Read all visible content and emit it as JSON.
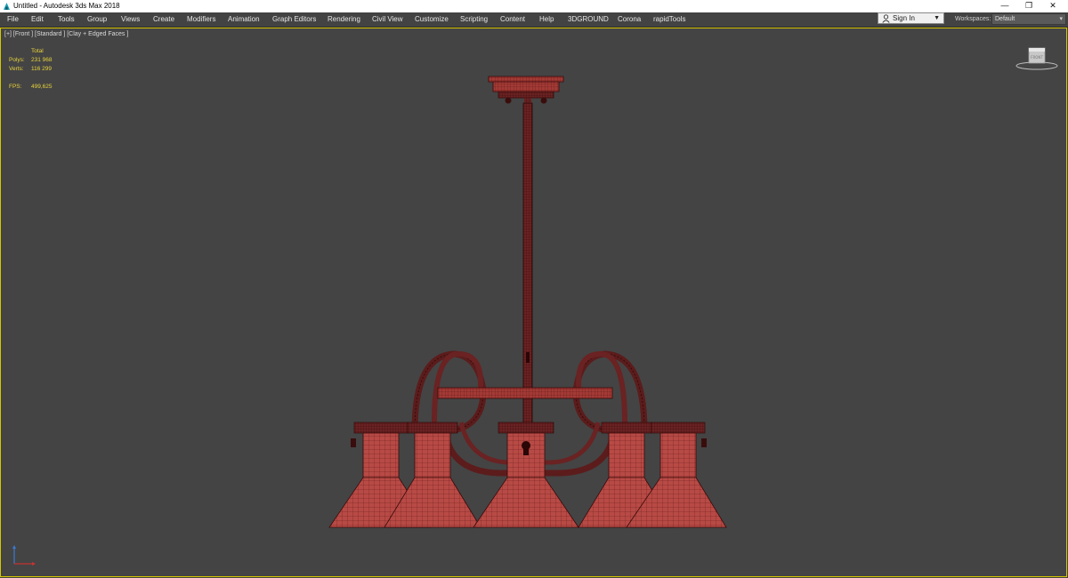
{
  "window": {
    "title": "Untitled - Autodesk 3ds Max 2018",
    "app_icon": "3ds-max-icon",
    "controls": {
      "minimize": "—",
      "restore": "❐",
      "close": "✕"
    }
  },
  "menubar": {
    "items": [
      "File",
      "Edit",
      "Tools",
      "Group",
      "Views",
      "Create",
      "Modifiers",
      "Animation",
      "Graph Editors",
      "Rendering",
      "Civil View",
      "Customize",
      "Scripting",
      "Content",
      "Help",
      "3DGROUND",
      "Corona",
      "rapidTools"
    ],
    "signin_label": "Sign In",
    "workspaces_label": "Workspaces:",
    "workspace_value": "Default"
  },
  "viewport": {
    "label": "[+] [Front ] [Standard ] [Clay + Edged Faces ]",
    "stats": {
      "total_label": "Total",
      "polys_label": "Polys:",
      "polys_value": "231 968",
      "verts_label": "Verts:",
      "verts_value": "116 299",
      "fps_label": "FPS:",
      "fps_value": "499,625"
    },
    "model_name": "chandelier-wireframe",
    "background": "#444444",
    "active_border": "#d6c700",
    "wire_color": "#8a3030"
  }
}
